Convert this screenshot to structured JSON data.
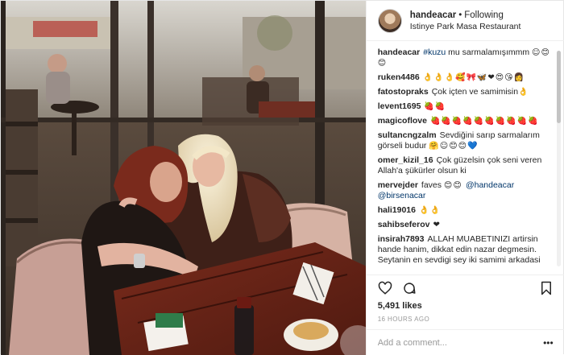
{
  "header": {
    "username": "handeacar",
    "separator": "•",
    "follow_status": "Following",
    "location": "Istinye Park Masa Restaurant"
  },
  "comments": [
    {
      "user": "handeacar",
      "parts": [
        {
          "t": "tag",
          "v": "#kuzu"
        },
        {
          "t": "text",
          "v": " mu sarmalamışımmm "
        },
        {
          "t": "emoji",
          "v": "☺😊😊"
        }
      ]
    },
    {
      "user": "ruken4486",
      "parts": [
        {
          "t": "emoji",
          "v": "👌👌👌🥰🎀🦋❤😍😘👩"
        }
      ]
    },
    {
      "user": "fatostopraks",
      "parts": [
        {
          "t": "text",
          "v": "Çok içten ve samimisin"
        },
        {
          "t": "emoji",
          "v": "👌"
        }
      ]
    },
    {
      "user": "levent1695",
      "parts": [
        {
          "t": "emoji",
          "v": "🍓🍓"
        }
      ]
    },
    {
      "user": "magicoflove",
      "parts": [
        {
          "t": "emoji",
          "v": "🍓🍓🍓🍓🍓🍓🍓🍓🍓🍓"
        }
      ]
    },
    {
      "user": "sultancngzalm",
      "parts": [
        {
          "t": "text",
          "v": "Sevdiğini sarıp sarmalarım görseli budur "
        },
        {
          "t": "emoji",
          "v": "🤗☺😊😊💙"
        }
      ]
    },
    {
      "user": "omer_kizil_16",
      "parts": [
        {
          "t": "text",
          "v": "Çok güzelsin çok seni veren Allah'a şükürler olsun ki"
        }
      ]
    },
    {
      "user": "mervejder",
      "parts": [
        {
          "t": "text",
          "v": "faves "
        },
        {
          "t": "emoji",
          "v": "😊😊 "
        },
        {
          "t": "tag",
          "v": "@handeacar"
        },
        {
          "t": "text",
          "v": " "
        },
        {
          "t": "tag",
          "v": "@birsenacar"
        }
      ]
    },
    {
      "user": "hali19016",
      "parts": [
        {
          "t": "emoji",
          "v": "👌👌"
        }
      ]
    },
    {
      "user": "sahibseferov",
      "parts": [
        {
          "t": "emoji",
          "v": "❤"
        }
      ]
    },
    {
      "user": "insirah7893",
      "parts": [
        {
          "t": "text",
          "v": "ALLAH MUABETINIZI artirsin hande hanim, dikkat edin nazar degmesin. Seytanin en sevdigi sey iki samimi arkadasi"
        }
      ]
    }
  ],
  "actions": {
    "like_icon": "heart-icon",
    "comment_icon": "comment-bubble-icon",
    "save_icon": "bookmark-icon"
  },
  "likes": "5,491 likes",
  "timestamp": "16 HOURS AGO",
  "add_comment": {
    "placeholder": "Add a comment...",
    "more_label": "•••"
  },
  "colors": {
    "text": "#262626",
    "link": "#003569",
    "muted": "#999999",
    "border": "#efefef"
  }
}
